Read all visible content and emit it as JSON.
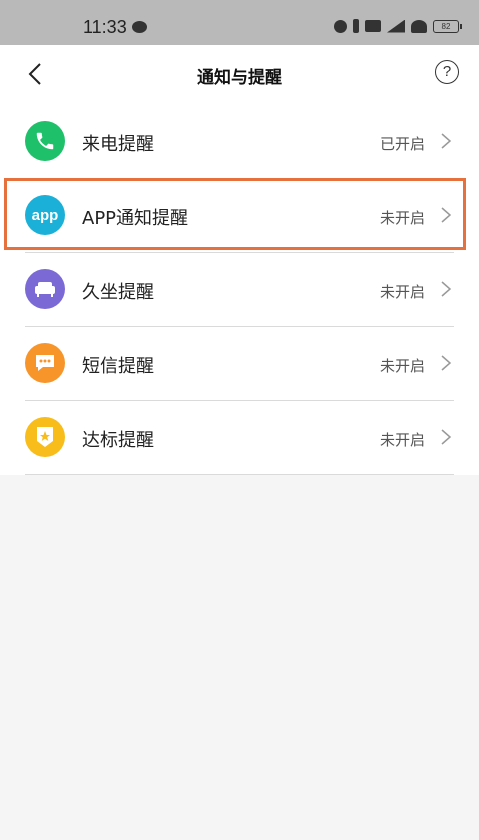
{
  "status_bar": {
    "time": "11:33",
    "battery": "82"
  },
  "header": {
    "title": "通知与提醒",
    "help_icon": "question-circle-icon",
    "back_icon": "chevron-left-icon"
  },
  "settings": [
    {
      "label": "来电提醒",
      "status": "已开启",
      "icon": "phone-icon",
      "color": "#1ec06a"
    },
    {
      "label": "APP通知提醒",
      "status": "未开启",
      "icon": "app-icon",
      "color": "#1ab0d8",
      "icon_text": "app"
    },
    {
      "label": "久坐提醒",
      "status": "未开启",
      "icon": "sofa-icon",
      "color": "#7b6ad6"
    },
    {
      "label": "短信提醒",
      "status": "未开启",
      "icon": "message-icon",
      "color": "#f7952a"
    },
    {
      "label": "达标提醒",
      "status": "未开启",
      "icon": "badge-icon",
      "color": "#f8bd1a"
    }
  ],
  "colors": {
    "highlight": "#e7713d",
    "statusbar": "#b9b9b9"
  }
}
